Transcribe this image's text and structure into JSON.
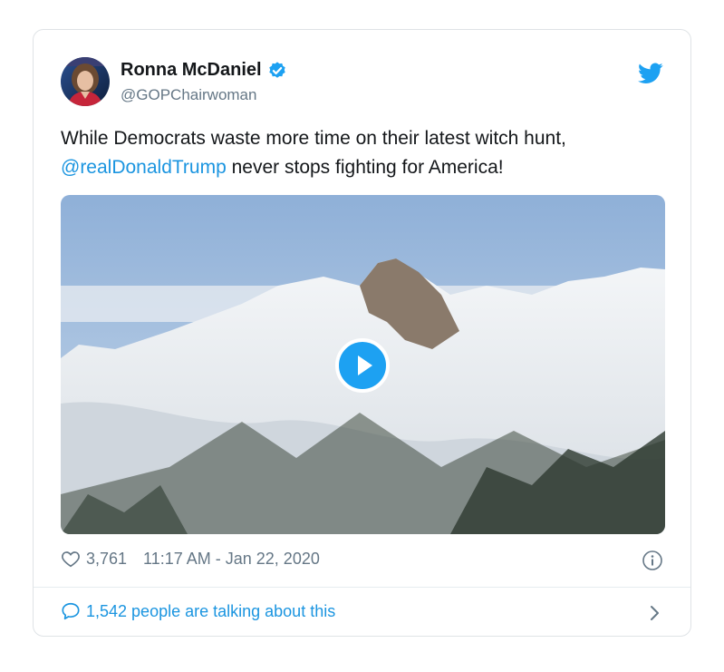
{
  "tweet": {
    "author_name": "Ronna McDaniel",
    "author_handle": "@GOPChairwoman",
    "text_before": "While Democrats waste more time on their latest witch hunt,",
    "mention": "@realDonaldTrump",
    "text_after": " never stops fighting for America!",
    "likes": "3,761",
    "timestamp": "11:17 AM - Jan 22, 2020",
    "talking": "1,542 people are talking about this"
  },
  "icons": {
    "verified": "verified-badge-icon",
    "brand": "twitter-bird-icon",
    "play": "play-icon",
    "like": "heart-icon",
    "info": "info-icon",
    "reply": "speech-bubble-icon",
    "more": "chevron-right-icon"
  },
  "colors": {
    "accent": "#1da1f2",
    "link": "#1b95e0",
    "muted": "#657786",
    "text": "#14171a",
    "border": "#dfe3e6"
  }
}
